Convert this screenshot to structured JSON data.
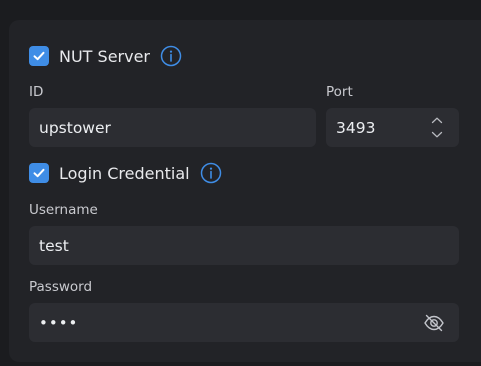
{
  "nut_server": {
    "checkbox_checked": true,
    "label": "NUT Server",
    "id_label": "ID",
    "id_value": "upstower",
    "port_label": "Port",
    "port_value": "3493"
  },
  "login_credential": {
    "checkbox_checked": true,
    "label": "Login Credential",
    "username_label": "Username",
    "username_value": "test",
    "password_label": "Password",
    "password_masked": "••••"
  },
  "icons": {
    "info": "info-circle-icon",
    "eye_off": "eye-off-icon",
    "stepper_up": "chevron-up-icon",
    "stepper_down": "chevron-down-icon"
  },
  "colors": {
    "accent": "#3f8de6",
    "panel": "#222327",
    "input": "#2c2d32",
    "background": "#1b1c1f"
  }
}
